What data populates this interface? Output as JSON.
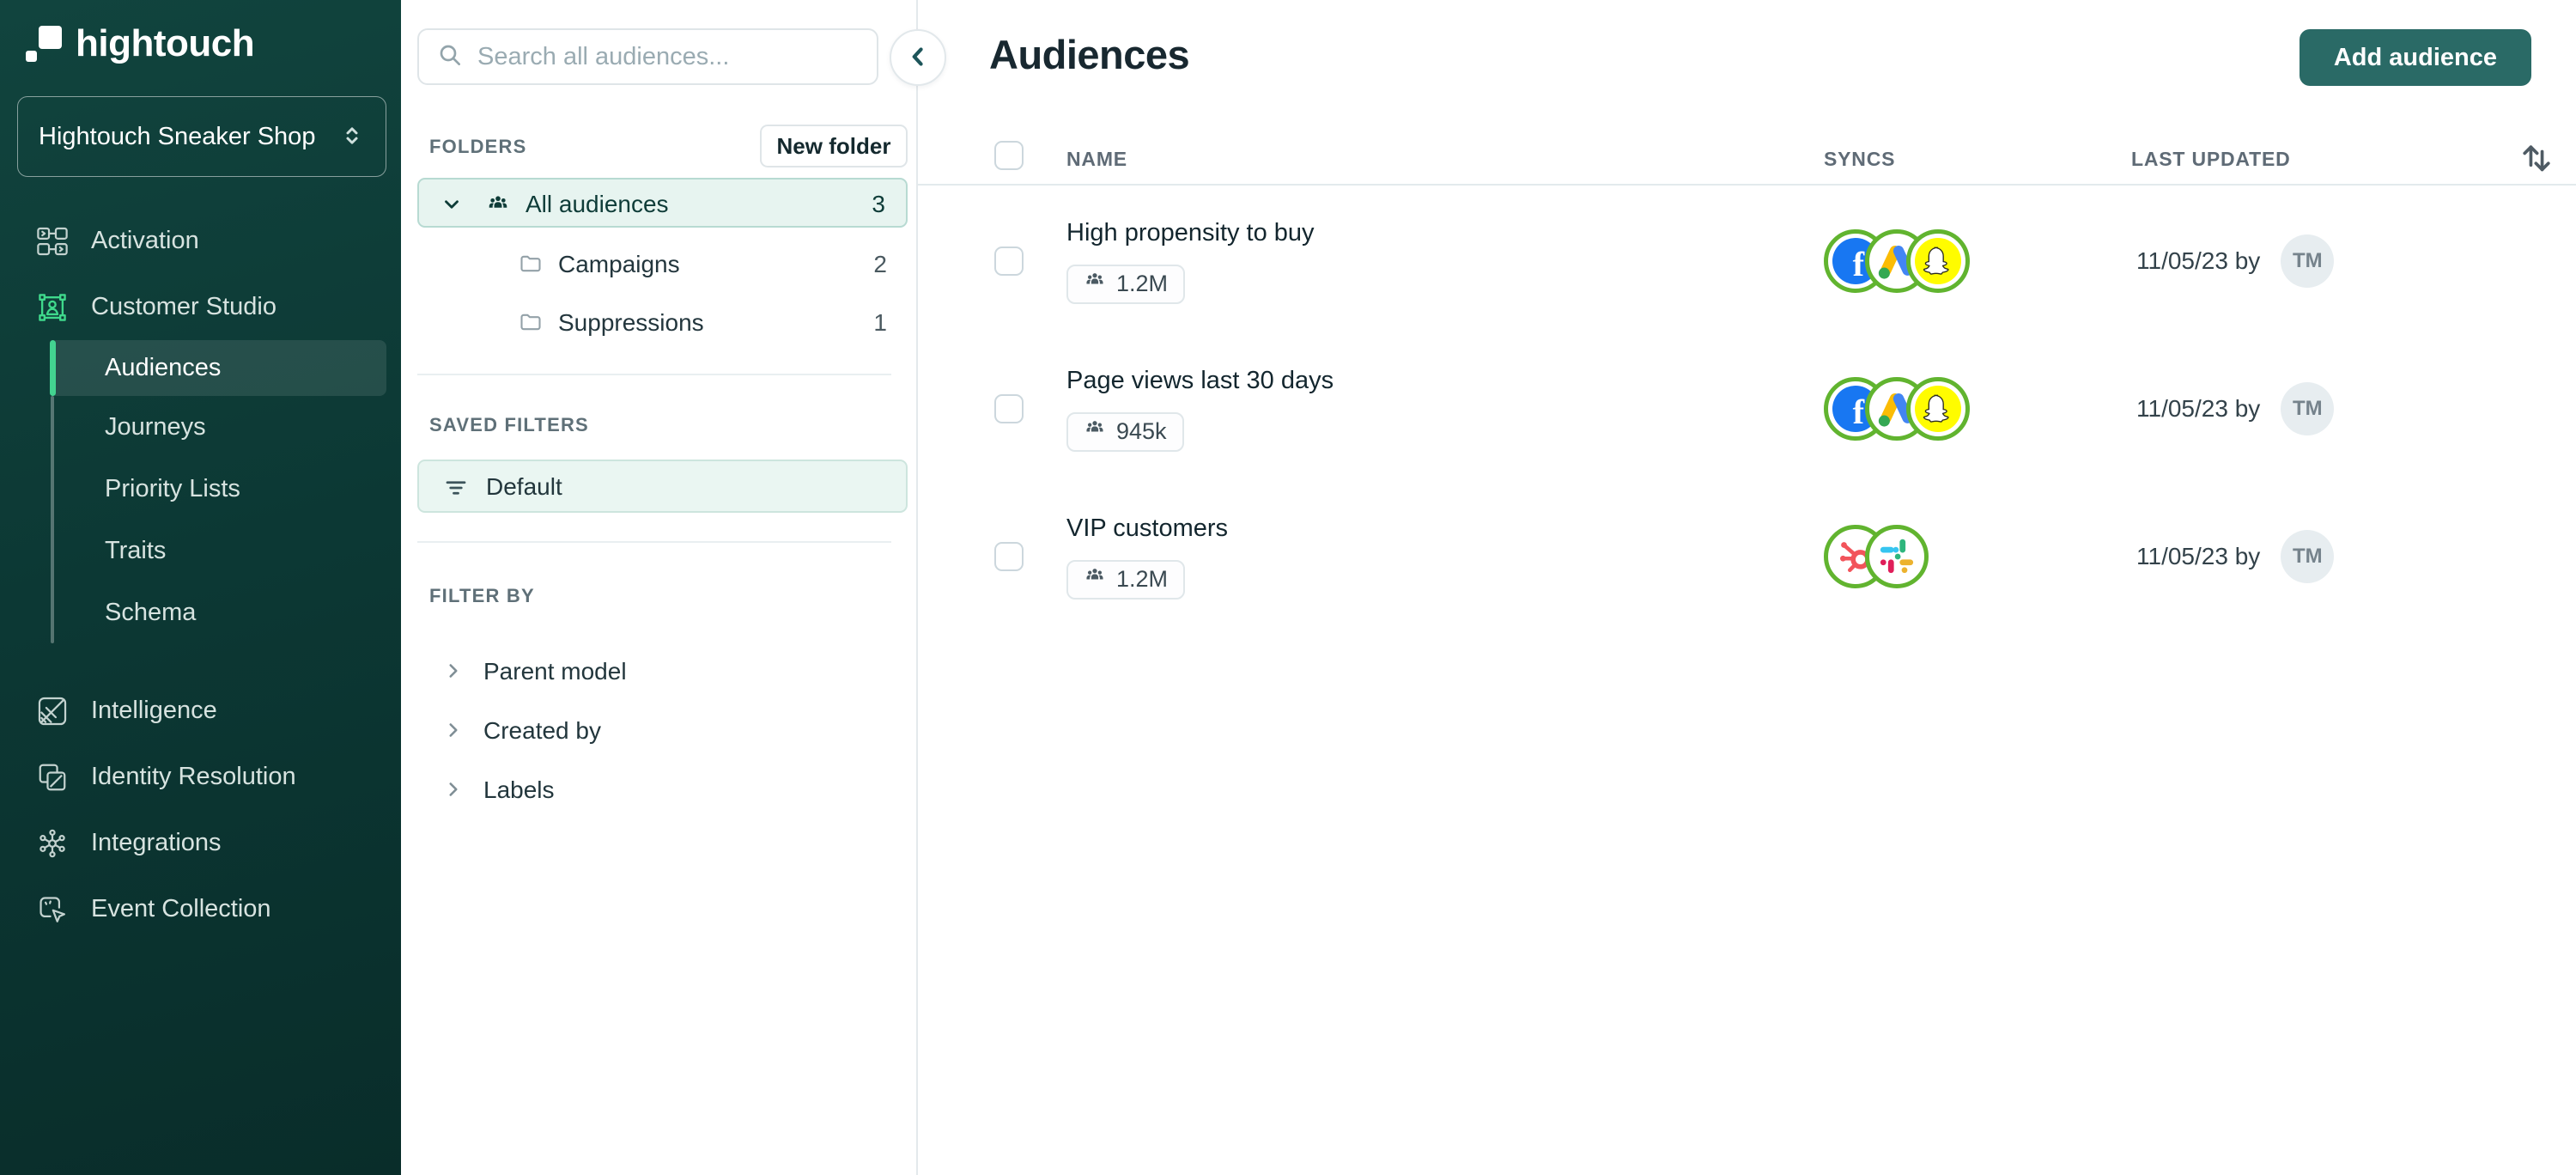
{
  "app": {
    "logo_text": "hightouch"
  },
  "workspace_selector": {
    "name": "Hightouch Sneaker Shop"
  },
  "sidebar": {
    "items": [
      {
        "label": "Activation"
      },
      {
        "label": "Customer Studio"
      },
      {
        "label": "Intelligence"
      },
      {
        "label": "Identity Resolution"
      },
      {
        "label": "Integrations"
      },
      {
        "label": "Event Collection"
      }
    ],
    "customer_studio_subitems": [
      {
        "label": "Audiences",
        "active": true
      },
      {
        "label": "Journeys"
      },
      {
        "label": "Priority Lists"
      },
      {
        "label": "Traits"
      },
      {
        "label": "Schema"
      }
    ]
  },
  "folders_panel": {
    "search": {
      "placeholder": "Search all audiences..."
    },
    "folders_section_label": "FOLDERS",
    "new_folder_button": "New folder",
    "folder_tree": [
      {
        "label": "All audiences",
        "count": "3",
        "selected": true
      },
      {
        "label": "Campaigns",
        "count": "2"
      },
      {
        "label": "Suppressions",
        "count": "1"
      }
    ],
    "saved_filters_label": "SAVED FILTERS",
    "saved_filters": [
      {
        "label": "Default"
      }
    ],
    "filter_by_label": "FILTER BY",
    "filter_groups": [
      {
        "label": "Parent model"
      },
      {
        "label": "Created by"
      },
      {
        "label": "Labels"
      }
    ]
  },
  "main": {
    "title": "Audiences",
    "add_audience_button": "Add audience",
    "table": {
      "headers": {
        "name": "NAME",
        "syncs": "SYNCS",
        "last_updated": "LAST UPDATED"
      },
      "rows": [
        {
          "name": "High propensity to buy",
          "size": "1.2M",
          "syncs": [
            "facebook",
            "google-ads",
            "snapchat"
          ],
          "last_updated": "11/05/23 by",
          "avatar_initials": "TM"
        },
        {
          "name": "Page views last 30 days",
          "size": "945k",
          "syncs": [
            "facebook",
            "google-ads",
            "snapchat"
          ],
          "last_updated": "11/05/23 by",
          "avatar_initials": "TM"
        },
        {
          "name": "VIP customers",
          "size": "1.2M",
          "syncs": [
            "hubspot",
            "slack"
          ],
          "last_updated": "11/05/23 by",
          "avatar_initials": "TM"
        }
      ]
    }
  },
  "colors": {
    "sidebar_bg": "#0c3834",
    "accent_green": "#43d390",
    "sync_ring_green": "#61b42f",
    "primary_button_teal": "#2a6a66",
    "selected_mint": "#e7f4f0",
    "facebook_blue": "#1877f2",
    "snapchat_yellow": "#fffc00"
  }
}
